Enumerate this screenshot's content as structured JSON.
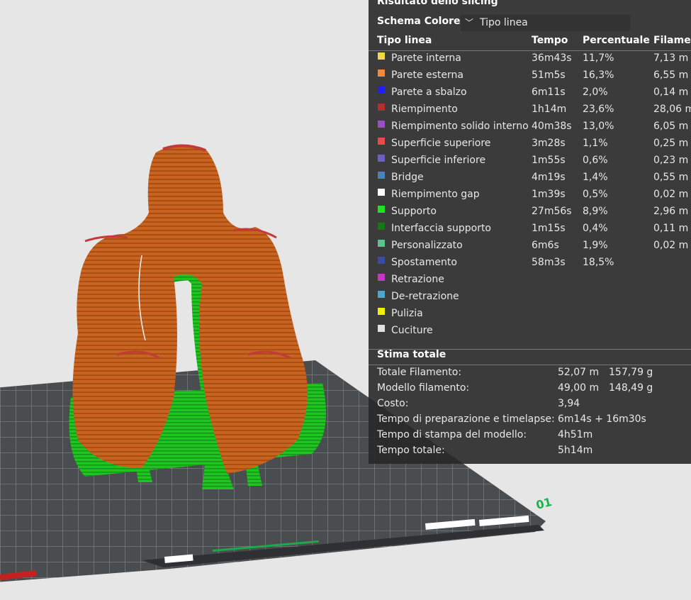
{
  "panel": {
    "title": "Risultato dello slicing",
    "scheme_label": "Schema Colore",
    "scheme_value": "Tipo linea",
    "columns": [
      "Tipo linea",
      "Tempo",
      "Percentuale",
      "Filamento"
    ],
    "rows": [
      {
        "name": "Parete interna",
        "color": "#f2d84b",
        "time": "36m43s",
        "pct": "11,7%",
        "fil": "7,13 m"
      },
      {
        "name": "Parete esterna",
        "color": "#f08a3c",
        "time": "51m5s",
        "pct": "16,3%",
        "fil": "6,55 m"
      },
      {
        "name": "Parete a sbalzo",
        "color": "#2020f0",
        "time": "6m11s",
        "pct": "2,0%",
        "fil": "0,14 m"
      },
      {
        "name": "Riempimento",
        "color": "#b22f2f",
        "time": "1h14m",
        "pct": "23,6%",
        "fil": "28,06 m"
      },
      {
        "name": "Riempimento solido interno",
        "color": "#9a4fc4",
        "time": "40m38s",
        "pct": "13,0%",
        "fil": "6,05 m"
      },
      {
        "name": "Superficie superiore",
        "color": "#e84a4a",
        "time": "3m28s",
        "pct": "1,1%",
        "fil": "0,25 m"
      },
      {
        "name": "Superficie inferiore",
        "color": "#6a60c8",
        "time": "1m55s",
        "pct": "0,6%",
        "fil": "0,23 m"
      },
      {
        "name": "Bridge",
        "color": "#4a7fc0",
        "time": "4m19s",
        "pct": "1,4%",
        "fil": "0,55 m"
      },
      {
        "name": "Riempimento gap",
        "color": "#ffffff",
        "time": "1m39s",
        "pct": "0,5%",
        "fil": "0,02 m"
      },
      {
        "name": "Supporto",
        "color": "#22e022",
        "time": "27m56s",
        "pct": "8,9%",
        "fil": "2,96 m"
      },
      {
        "name": "Interfaccia supporto",
        "color": "#127a12",
        "time": "1m15s",
        "pct": "0,4%",
        "fil": "0,11 m"
      },
      {
        "name": "Personalizzato",
        "color": "#5ec28e",
        "time": "6m6s",
        "pct": "1,9%",
        "fil": "0,02 m"
      },
      {
        "name": "Spostamento",
        "color": "#3a4aa8",
        "time": "58m3s",
        "pct": "18,5%",
        "fil": ""
      },
      {
        "name": "Retrazione",
        "color": "#c438c4",
        "time": "",
        "pct": "",
        "fil": ""
      },
      {
        "name": "De-retrazione",
        "color": "#4aa8d0",
        "time": "",
        "pct": "",
        "fil": ""
      },
      {
        "name": "Pulizia",
        "color": "#f0f000",
        "time": "",
        "pct": "",
        "fil": ""
      },
      {
        "name": "Cuciture",
        "color": "#e0e0e0",
        "time": "",
        "pct": "",
        "fil": ""
      }
    ],
    "summary": {
      "title": "Stima totale",
      "rows": [
        {
          "label": "Totale Filamento:",
          "v1": "52,07 m",
          "v2": "157,79 g"
        },
        {
          "label": "Modello filamento:",
          "v1": "49,00 m",
          "v2": "148,49 g"
        },
        {
          "label": "Costo:",
          "v1": "3,94",
          "v2": ""
        },
        {
          "label": "Tempo di preparazione e timelapse:",
          "v1": "6m14s + 16m30s",
          "v2": ""
        },
        {
          "label": "Tempo di stampa del modello:",
          "v1": "4h51m",
          "v2": ""
        },
        {
          "label": "Tempo totale:",
          "v1": "5h14m",
          "v2": ""
        }
      ]
    }
  },
  "plate": {
    "label": "01"
  },
  "colors": {
    "model": "#c8601e",
    "support": "#1ec81e",
    "plate": "#4a4d50"
  }
}
